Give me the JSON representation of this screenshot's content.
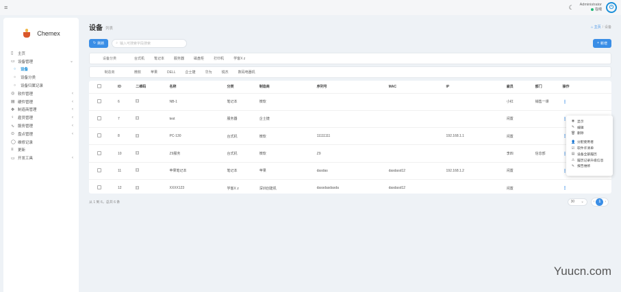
{
  "topbar": {
    "user_name": "Administrator",
    "status": "在线"
  },
  "brand": {
    "name": "Chemex"
  },
  "nav": [
    {
      "icon": "▯",
      "label": "主页",
      "chevron": ""
    },
    {
      "icon": "▭",
      "label": "设备管理",
      "chevron": "⌄"
    },
    {
      "icon": "○",
      "label": "设备",
      "chevron": "",
      "sub": true,
      "active": true
    },
    {
      "icon": "○",
      "label": "设备分类",
      "chevron": "",
      "sub": true
    },
    {
      "icon": "○",
      "label": "设备归属记录",
      "chevron": "",
      "sub": true
    },
    {
      "icon": "◎",
      "label": "软件管理",
      "chevron": "‹"
    },
    {
      "icon": "▤",
      "label": "硬件管理",
      "chevron": "‹"
    },
    {
      "icon": "✥",
      "label": "制造商管理",
      "chevron": "‹"
    },
    {
      "icon": "♀",
      "label": "雇员管理",
      "chevron": "‹"
    },
    {
      "icon": "∿",
      "label": "服务管理",
      "chevron": "‹"
    },
    {
      "icon": "⊙",
      "label": "盘点管理",
      "chevron": "‹"
    },
    {
      "icon": "◯",
      "label": "维修记录",
      "chevron": ""
    },
    {
      "icon": "≡",
      "label": "更新",
      "chevron": ""
    },
    {
      "icon": "▭",
      "label": "开发工具",
      "chevron": "‹"
    }
  ],
  "page": {
    "title": "设备",
    "subtitle": "列表",
    "breadcrumb_home": "主页",
    "breadcrumb_current": "设备"
  },
  "toolbar": {
    "refresh": "刷新",
    "search_placeholder": "输入可搜索字段搜索",
    "new": "新增"
  },
  "filters": [
    {
      "label": "设备分类",
      "options": [
        "台式机",
        "笔记本",
        "服务器",
        "磁盘柜",
        "打印机",
        "学客X z"
      ]
    },
    {
      "label": "制造商",
      "options": [
        "微软",
        "苹果",
        "DELL",
        "企士捷",
        "华为",
        "锐杰",
        "数码电器机"
      ]
    }
  ],
  "table": {
    "headers": [
      "ID",
      "二维码",
      "名称",
      "分类",
      "制造商",
      "序列号",
      "MAC",
      "IP",
      "雇员",
      "部门",
      "操作"
    ],
    "rows": [
      [
        "6",
        "NB-1",
        "笔记本",
        "微软",
        "",
        "",
        "",
        "小红",
        "销售一课"
      ],
      [
        "7",
        "test",
        "服务器",
        "企士捷",
        "",
        "",
        "",
        "闲置",
        ""
      ],
      [
        "8",
        "PC-130",
        "台式机",
        "微软",
        "11111111",
        "",
        "192.168.1.1",
        "闲置",
        ""
      ],
      [
        "10",
        "Z9服务",
        "台式机",
        "微软",
        "Z9",
        "",
        "",
        "李四",
        "信息部"
      ],
      [
        "11",
        "苹果笔记本",
        "笔记本",
        "苹果",
        "dasdas",
        "dasdasd12",
        "192.168.1.2",
        "闲置",
        ""
      ],
      [
        "12",
        "XXXX123",
        "学客X z",
        "深圳创建机",
        "dassdasdasda",
        "dasdasd12",
        "",
        "闲置",
        ""
      ]
    ]
  },
  "dropdown": [
    {
      "icon": "◉",
      "label": "显示"
    },
    {
      "icon": "✎",
      "label": "编辑"
    },
    {
      "icon": "🗑",
      "label": "删除"
    },
    {
      "icon": "👤",
      "label": "分配使用者"
    },
    {
      "icon": "☑",
      "label": "软件许清单"
    },
    {
      "icon": "▤",
      "label": "设备全部履历"
    },
    {
      "icon": "⚠",
      "label": "履历记录升级信息"
    },
    {
      "icon": "✎",
      "label": "报告维修"
    }
  ],
  "footer": {
    "summary": "从 1 到 6，总共 6 条",
    "per_page": "30",
    "current_page": "1"
  },
  "watermark": "Yuucn.com"
}
